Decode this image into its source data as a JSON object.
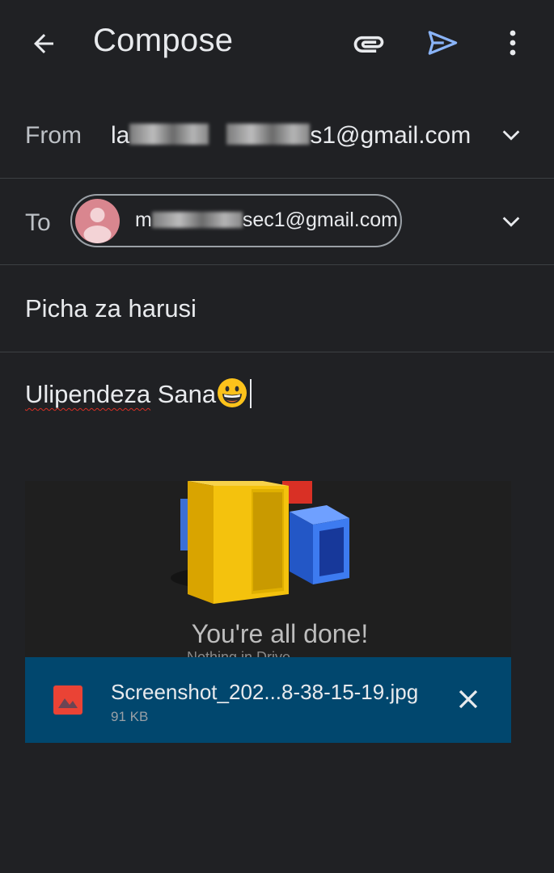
{
  "toolbar": {
    "title": "Compose",
    "back_icon": "arrow-back-icon",
    "attach_icon": "paperclip-icon",
    "send_icon": "send-icon",
    "more_icon": "more-vert-icon",
    "send_color": "#8ab4f8"
  },
  "from": {
    "label": "From",
    "value_prefix": "la",
    "value_suffix": "s1@gmail.com"
  },
  "to": {
    "label": "To",
    "recipient_prefix": "m",
    "recipient_suffix": "sec1@gmail.com",
    "avatar_color": "#d9868f"
  },
  "subject": {
    "value": "Picha za harusi"
  },
  "body": {
    "word1": "Ulipendeza",
    "word2": " Sana",
    "emoji": "😀"
  },
  "preview": {
    "caption": "You're all done!",
    "subcaption": "Nothing in Drive"
  },
  "attachment": {
    "filename": "Screenshot_202...8-38-15-19.jpg",
    "size": "91 KB",
    "icon": "image-file-icon",
    "icon_color": "#ea4335",
    "bar_color": "#01476e"
  }
}
